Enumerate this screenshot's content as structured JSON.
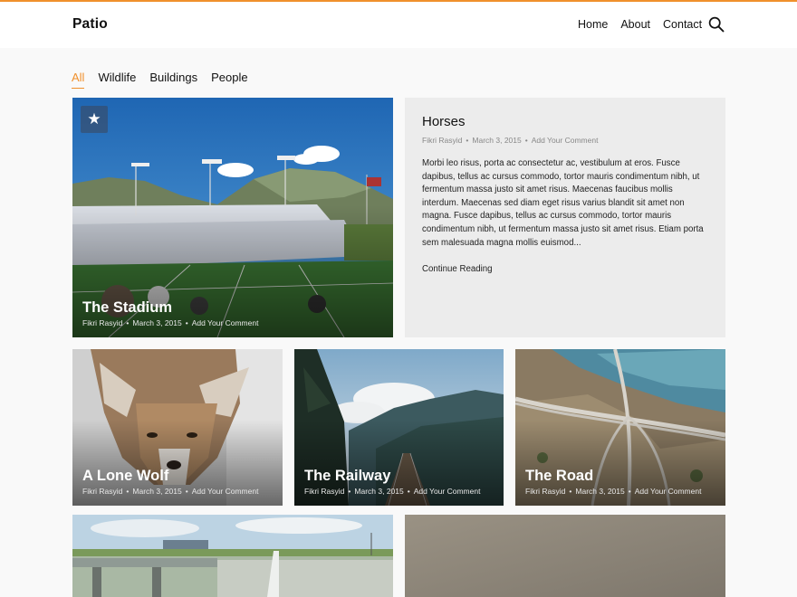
{
  "site": {
    "logo": "Patio"
  },
  "nav": {
    "items": [
      "Home",
      "About",
      "Contact"
    ]
  },
  "filters": [
    {
      "label": "All",
      "active": true
    },
    {
      "label": "Wildlife",
      "active": false
    },
    {
      "label": "Buildings",
      "active": false
    },
    {
      "label": "People",
      "active": false
    }
  ],
  "posts": {
    "stadium": {
      "title": "The Stadium",
      "author": "Fikri Rasyid",
      "date": "March 3, 2015",
      "comment": "Add Your Comment",
      "featured_icon": "star-icon"
    },
    "horses": {
      "title": "Horses",
      "author": "Fikri Rasyid",
      "date": "March 3, 2015",
      "comment": "Add Your Comment",
      "excerpt": "Morbi leo risus, porta ac consectetur ac, vestibulum at eros. Fusce dapibus, tellus ac cursus commodo, tortor mauris condimentum nibh, ut fermentum massa justo sit amet risus. Maecenas faucibus mollis interdum. Maecenas sed diam eget risus varius blandit sit amet non magna. Fusce dapibus, tellus ac cursus commodo, tortor mauris condimentum nibh, ut fermentum massa justo sit amet risus. Etiam porta sem malesuada magna mollis euismod...",
      "more": "Continue Reading"
    },
    "wolf": {
      "title": "A Lone Wolf",
      "author": "Fikri Rasyid",
      "date": "March 3, 2015",
      "comment": "Add Your Comment"
    },
    "railway": {
      "title": "The Railway",
      "author": "Fikri Rasyid",
      "date": "March 3, 2015",
      "comment": "Add Your Comment"
    },
    "road": {
      "title": "The Road",
      "author": "Fikri Rasyid",
      "date": "March 3, 2015",
      "comment": "Add Your Comment"
    }
  },
  "colors": {
    "accent": "#f0902c",
    "card_bg": "#ececec"
  }
}
